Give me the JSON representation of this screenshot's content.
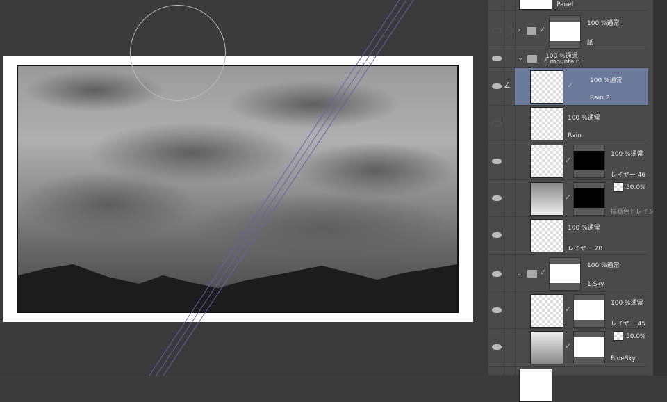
{
  "layers": [
    {
      "name": "Panel"
    },
    {
      "name": "紙",
      "blend": "100 %通常"
    },
    {
      "name": "6.mountain",
      "blend": "100 %通過"
    },
    {
      "name": "Rain 2",
      "blend": "100 %通常"
    },
    {
      "name": "Rain",
      "blend": "100 %通常"
    },
    {
      "name": "レイヤー 46",
      "blend": "100 %通常"
    },
    {
      "name": "描画色ドレイン",
      "blend": "50.0%"
    },
    {
      "name": "レイヤー 20",
      "blend": "100 %通常"
    },
    {
      "name": "1.Sky",
      "blend": "100 %通常"
    },
    {
      "name": "レイヤー 45",
      "blend": "100 %通常"
    },
    {
      "name": "BlueSky",
      "blend": "50.0%"
    }
  ],
  "colors": {
    "selection": "#6b7a9a",
    "ruler": "#6a5fb0"
  }
}
